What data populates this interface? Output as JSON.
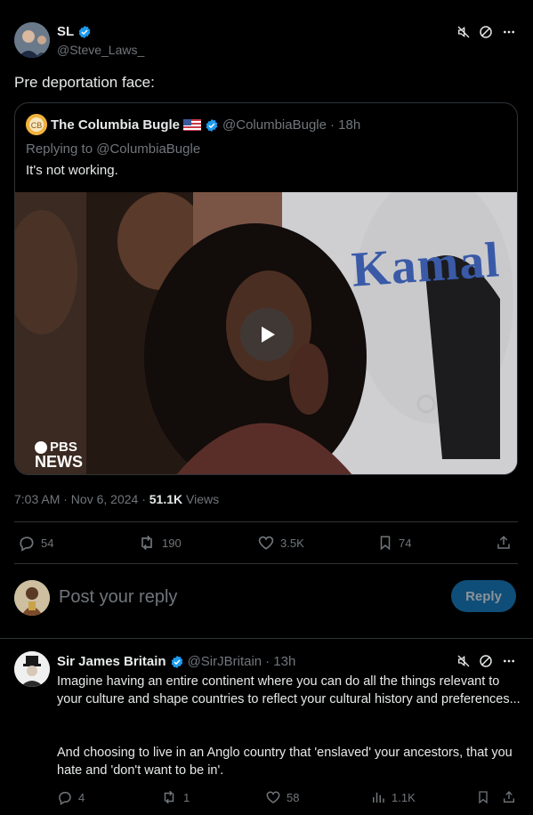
{
  "post": {
    "author_name": "SL",
    "author_handle": "@Steve_Laws_",
    "text": "Pre deportation face:",
    "timestamp": "7:03 AM · Nov 6, 2024 · ",
    "views_count": "51.1K",
    "views_label": "Views",
    "replies": "54",
    "reposts": "190",
    "likes": "3.5K",
    "bookmarks": "74"
  },
  "quoted": {
    "author_name": "The Columbia Bugle",
    "flag": "🇺🇸",
    "author_handle": "@ColumbiaBugle",
    "age": "· 18h",
    "replying_to": "Replying to @ColumbiaBugle",
    "text": "It's not working.",
    "video_overlay_text": "Kamal",
    "video_logo_line1": "PBS",
    "video_logo_line2": "NEWS"
  },
  "reply_box": {
    "placeholder": "Post your reply",
    "button_label": "Reply"
  },
  "reply": {
    "author_name": "Sir James Britain",
    "author_handle": "@SirJBritain",
    "age": "· 13h",
    "text_p1": "Imagine having an entire continent where you can do all the things relevant to your culture and shape countries to reflect your cultural history and preferences...",
    "text_p2": "And choosing to live in an Anglo country that 'enslaved' your ancestors, that you hate and 'don't want to be in'.",
    "replies": "4",
    "reposts": "1",
    "likes": "58",
    "views": "1.1K"
  },
  "colors": {
    "accent": "#1d9bf0",
    "reply_button_bg": "#0f4e78",
    "divider": "#2f3336"
  }
}
